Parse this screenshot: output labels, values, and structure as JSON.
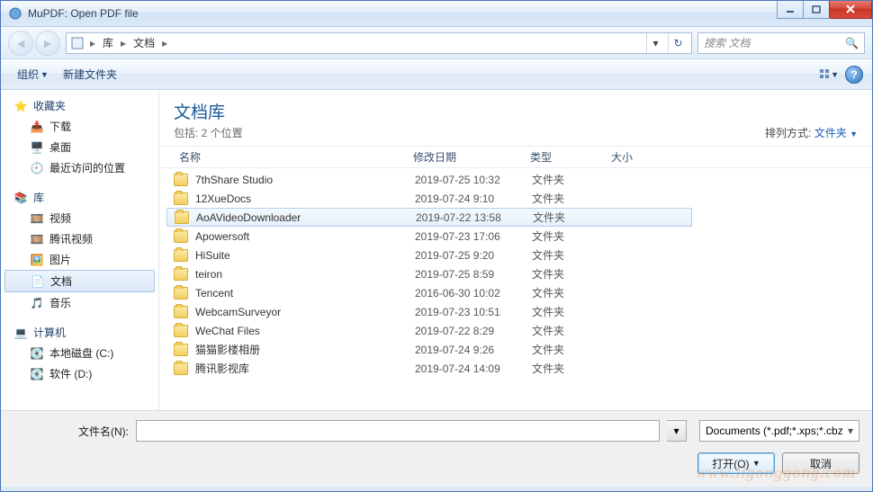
{
  "window": {
    "title": "MuPDF: Open PDF file"
  },
  "address": {
    "crumbs": [
      "库",
      "文档"
    ],
    "search_placeholder": "搜索 文档"
  },
  "toolbar": {
    "organize": "组织",
    "new_folder": "新建文件夹"
  },
  "library": {
    "title": "文档库",
    "subtitle": "包括: 2 个位置",
    "sort_label": "排列方式:",
    "sort_value": "文件夹"
  },
  "columns": {
    "name": "名称",
    "date": "修改日期",
    "type": "类型",
    "size": "大小"
  },
  "sidebar": {
    "favorites": {
      "label": "收藏夹",
      "items": [
        "下载",
        "桌面",
        "最近访问的位置"
      ]
    },
    "libraries": {
      "label": "库",
      "items": [
        "视频",
        "腾讯视频",
        "图片",
        "文档",
        "音乐"
      ],
      "selected": 3
    },
    "computer": {
      "label": "计算机",
      "items": [
        "本地磁盘 (C:)",
        "软件 (D:)"
      ]
    }
  },
  "files": [
    {
      "name": "7thShare Studio",
      "date": "2019-07-25 10:32",
      "type": "文件夹"
    },
    {
      "name": "12XueDocs",
      "date": "2019-07-24 9:10",
      "type": "文件夹"
    },
    {
      "name": "AoAVideoDownloader",
      "date": "2019-07-22 13:58",
      "type": "文件夹",
      "selected": true
    },
    {
      "name": "Apowersoft",
      "date": "2019-07-23 17:06",
      "type": "文件夹"
    },
    {
      "name": "HiSuite",
      "date": "2019-07-25 9:20",
      "type": "文件夹"
    },
    {
      "name": "teiron",
      "date": "2019-07-25 8:59",
      "type": "文件夹"
    },
    {
      "name": "Tencent",
      "date": "2016-06-30 10:02",
      "type": "文件夹"
    },
    {
      "name": "WebcamSurveyor",
      "date": "2019-07-23 10:51",
      "type": "文件夹"
    },
    {
      "name": "WeChat Files",
      "date": "2019-07-22 8:29",
      "type": "文件夹"
    },
    {
      "name": "猫猫影楼相册",
      "date": "2019-07-24 9:26",
      "type": "文件夹"
    },
    {
      "name": "腾讯影视库",
      "date": "2019-07-24 14:09",
      "type": "文件夹"
    }
  ],
  "bottom": {
    "filename_label": "文件名(N):",
    "filter": "Documents (*.pdf;*.xps;*.cbz",
    "open": "打开(O)",
    "cancel": "取消"
  },
  "watermark": "www.ligonggong.com"
}
